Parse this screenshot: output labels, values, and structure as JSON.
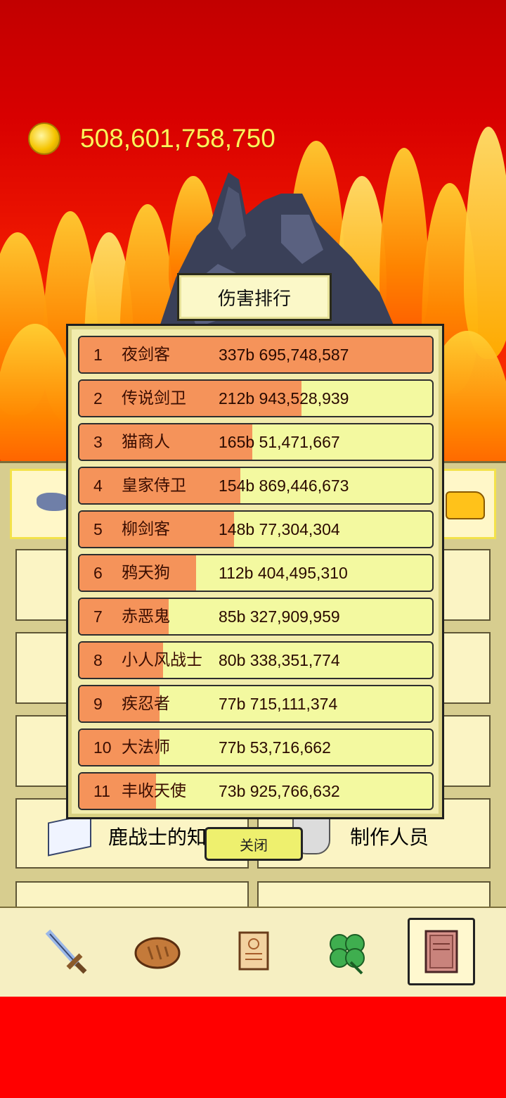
{
  "gold": {
    "amount": "508,601,758,750"
  },
  "ranking": {
    "title": "伤害排行",
    "rows": [
      {
        "rank": "1",
        "name": "夜剑客",
        "damage": "337b 695,748,587",
        "share": 1.0
      },
      {
        "rank": "2",
        "name": "传说剑卫",
        "damage": "212b 943,528,939",
        "share": 0.629
      },
      {
        "rank": "3",
        "name": "猫商人",
        "damage": "165b 51,471,667",
        "share": 0.49
      },
      {
        "rank": "4",
        "name": "皇家侍卫",
        "damage": "154b 869,446,673",
        "share": 0.457
      },
      {
        "rank": "5",
        "name": "柳剑客",
        "damage": "148b 77,304,304",
        "share": 0.438
      },
      {
        "rank": "6",
        "name": "鸦天狗",
        "damage": "112b 404,495,310",
        "share": 0.331
      },
      {
        "rank": "7",
        "name": "赤恶鬼",
        "damage": "85b 327,909,959",
        "share": 0.252
      },
      {
        "rank": "8",
        "name": "小人风战士",
        "damage": "80b 338,351,774",
        "share": 0.238
      },
      {
        "rank": "9",
        "name": "疾忍者",
        "damage": "77b 715,111,374",
        "share": 0.228
      },
      {
        "rank": "10",
        "name": "大法师",
        "damage": "77b 53,716,662",
        "share": 0.228
      },
      {
        "rank": "11",
        "name": "丰收天使",
        "damage": "73b 925,766,632",
        "share": 0.218
      }
    ],
    "close_label": "关闭"
  },
  "background_menu": {
    "knowledge_label": "鹿战士的知识",
    "credits_label": "制作人员"
  },
  "bottom_nav": {
    "items": [
      {
        "icon": "sword-icon"
      },
      {
        "icon": "bread-icon"
      },
      {
        "icon": "scroll-icon"
      },
      {
        "icon": "clover-icon"
      },
      {
        "icon": "book-icon",
        "active": true
      }
    ]
  }
}
